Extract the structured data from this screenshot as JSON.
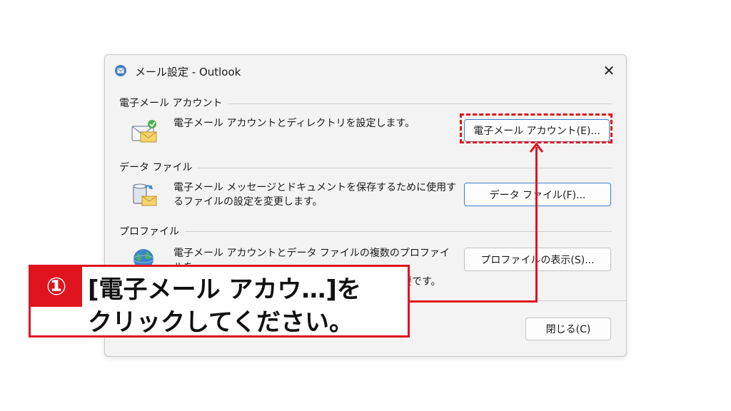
{
  "window": {
    "title": "メール設定 - Outlook",
    "close_glyph": "✕"
  },
  "sections": [
    {
      "label": "電子メール アカウント",
      "description": "電子メール アカウントとディレクトリを設定します。",
      "button_label": "電子メール アカウント(E)...",
      "icon": "mail-account-icon"
    },
    {
      "label": "データ ファイル",
      "description_line1": "電子メール メッセージとドキュメントを保存するために使用す",
      "description_line2": "るファイルの設定を変更します。",
      "button_label": "データ ファイル(F)...",
      "icon": "data-file-icon"
    },
    {
      "label": "プロファイル",
      "description_line1": "電子メール アカウントとデータ ファイルの複数のプロファイルを",
      "description_line2": "設定します。通常は、1 つのプロファイルだけが必要です。",
      "button_label": "プロファイルの表示(S)...",
      "icon": "profile-globe-icon"
    }
  ],
  "footer": {
    "close_button_label": "閉じる(C)"
  },
  "callout": {
    "number": "①",
    "line1": "[電子メール アカウ…]を",
    "line2": "クリックしてください。"
  },
  "colors": {
    "accent_red": "#e0141e",
    "button_focus_blue": "#3b7fd0",
    "dialog_bg": "#f3f3f3"
  }
}
